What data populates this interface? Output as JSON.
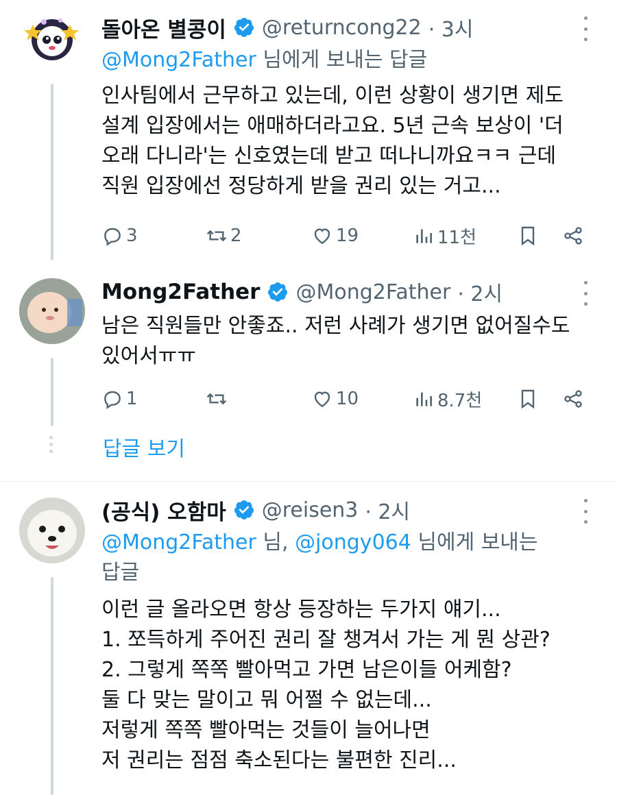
{
  "tweets": [
    {
      "name": "돌아온 별콩이",
      "handle": "@returncong22",
      "time": "· 3시",
      "reply_prefix_mention": "@Mong2Father",
      "reply_suffix": " 님에게 보내는 답글",
      "body": [
        "인사팀에서 근무하고 있는데, 이런 상황이 생기면 제도",
        "설계 입장에서는 애매하더라고요. 5년 근속 보상이 '더",
        "오래 다니라'는 신호였는데 받고 떠나니까요ㅋㅋ 근데",
        "직원 입장에선 정당하게 받을 권리 있는 거고..."
      ],
      "replies": "3",
      "retweets": "2",
      "likes": "19",
      "views": "11천"
    },
    {
      "name": "Mong2Father",
      "handle": "@Mong2Father",
      "time": "· 2시",
      "body": [
        "남은 직원들만 안좋죠.. 저런 사례가 생기면 없어질수도",
        "있어서ㅠㅠ"
      ],
      "replies": "1",
      "retweets": "",
      "likes": "10",
      "views": "8.7천"
    },
    {
      "name": "(공식) 오함마",
      "handle": "@reisen3",
      "time": "· 2시",
      "reply_line1_mention1": "@Mong2Father",
      "reply_line1_mid": " 님, ",
      "reply_line1_mention2": "@jongy064",
      "reply_line1_suffix": " 님에게 보내는",
      "reply_line2": "답글",
      "body": [
        "이런 글 올라오면 항상 등장하는 두가지 얘기...",
        "1. 쪼득하게 주어진 권리 잘 챙겨서 가는 게 뭔 상관?",
        "2. 그렇게 쪽쪽 빨아먹고 가면 남은이들 어케함?",
        "둘 다 맞는 말이고 뭐 어쩔 수 없는데...",
        "저렇게 쪽쪽 빨아먹는 것들이 늘어나면",
        "저 권리는 점점 축소된다는 불편한 진리..."
      ]
    }
  ],
  "show_replies_label": "답글 보기",
  "colors": {
    "accent": "#1d9bf0",
    "verified": "#1d9bf0",
    "muted": "#536471"
  }
}
